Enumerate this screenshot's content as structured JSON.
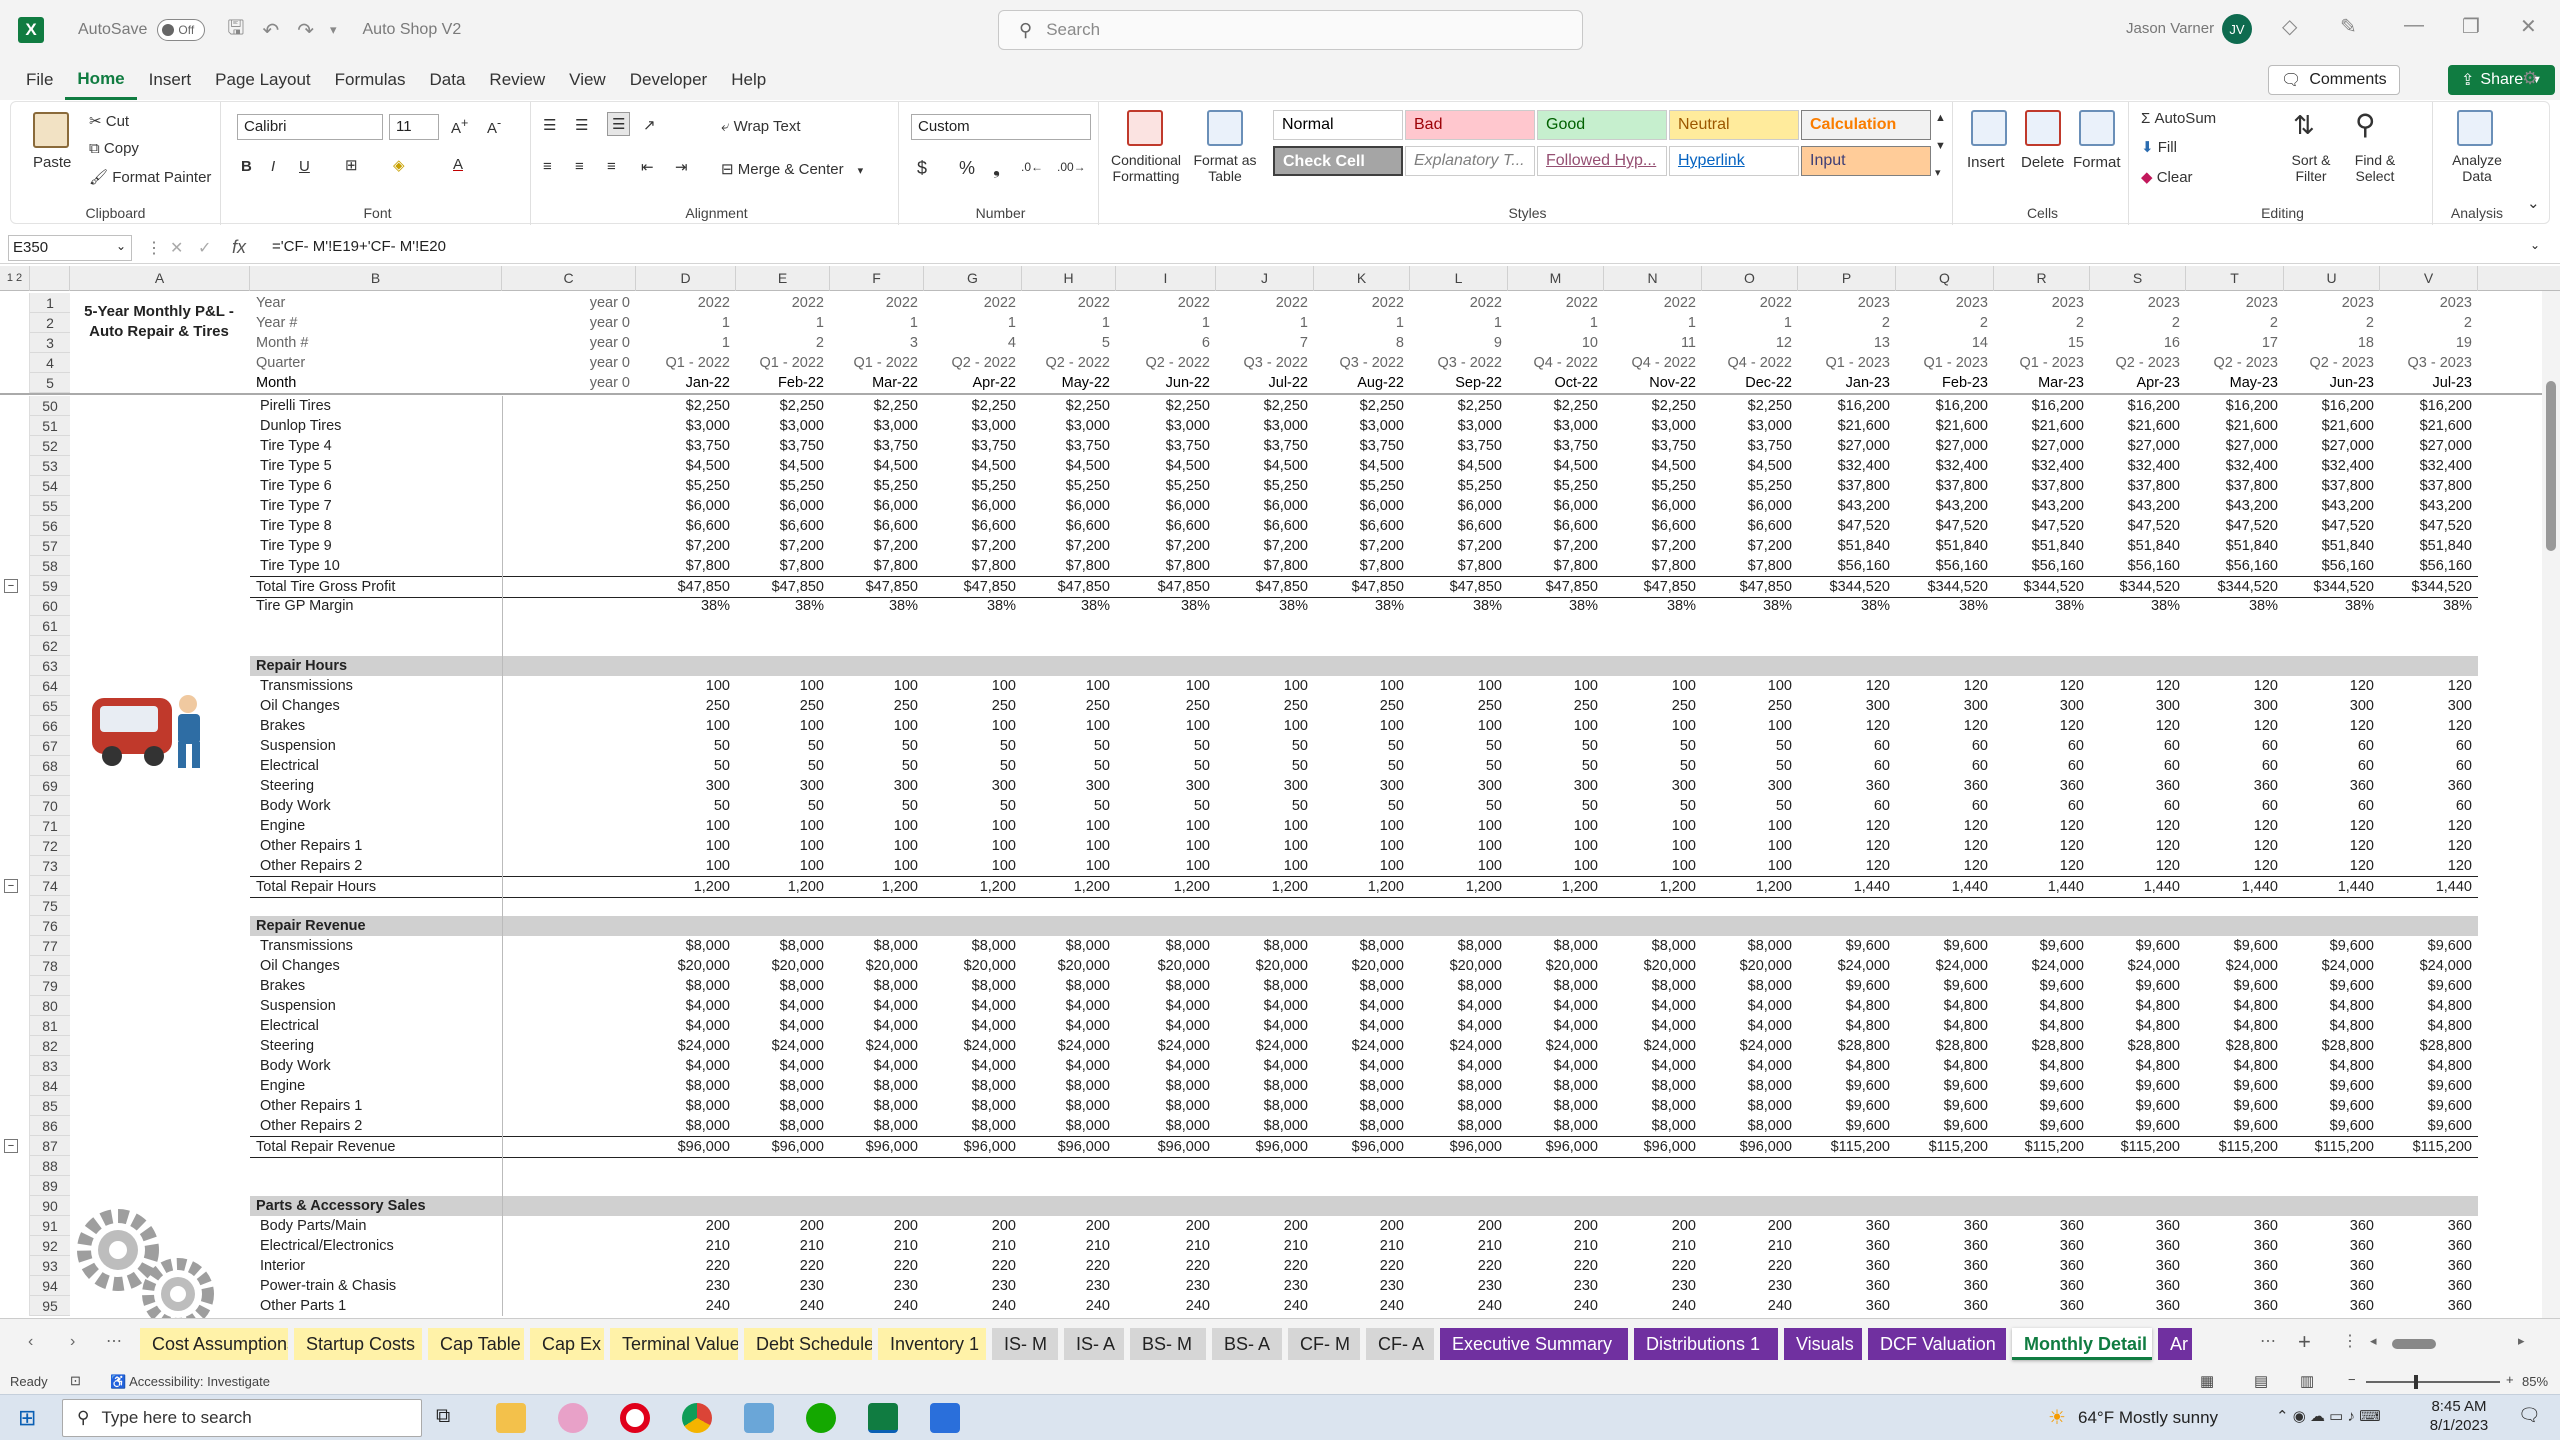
{
  "titlebar": {
    "autosave": "AutoSave",
    "toggle": "Off",
    "filename": "Auto Shop V2",
    "search": "Search",
    "user": "Jason Varner",
    "initials": "JV"
  },
  "menu": [
    "File",
    "Home",
    "Insert",
    "Page Layout",
    "Formulas",
    "Data",
    "Review",
    "View",
    "Developer",
    "Help"
  ],
  "menu_right": {
    "comments": "Comments",
    "share": "Share"
  },
  "ribbon": {
    "clipboard": {
      "paste": "Paste",
      "cut": "Cut",
      "copy": "Copy",
      "format_painter": "Format Painter",
      "label": "Clipboard"
    },
    "font": {
      "name": "Calibri",
      "size": "11",
      "label": "Font"
    },
    "alignment": {
      "wrap": "Wrap Text",
      "merge": "Merge & Center",
      "label": "Alignment"
    },
    "number": {
      "format": "Custom",
      "label": "Number"
    },
    "styles": {
      "cond": "Conditional Formatting",
      "table": "Format as Table",
      "cells": [
        {
          "t": "Normal",
          "bg": "#ffffff",
          "c": "#000000"
        },
        {
          "t": "Bad",
          "bg": "#ffc7ce",
          "c": "#9c0006"
        },
        {
          "t": "Good",
          "bg": "#c6efce",
          "c": "#006100"
        },
        {
          "t": "Neutral",
          "bg": "#ffeb9c",
          "c": "#9c5700"
        },
        {
          "t": "Calculation",
          "bg": "#f2f2f2",
          "c": "#fa7d00"
        },
        {
          "t": "Check Cell",
          "bg": "#a5a5a5",
          "c": "#ffffff"
        },
        {
          "t": "Explanatory T...",
          "bg": "#ffffff",
          "c": "#7f7f7f"
        },
        {
          "t": "Followed Hyp...",
          "bg": "#ffffff",
          "c": "#954f72"
        },
        {
          "t": "Hyperlink",
          "bg": "#ffffff",
          "c": "#0563c1"
        },
        {
          "t": "Input",
          "bg": "#ffcc99",
          "c": "#3f3f76"
        }
      ],
      "label": "Styles"
    },
    "cells": {
      "insert": "Insert",
      "delete": "Delete",
      "format": "Format",
      "label": "Cells"
    },
    "editing": {
      "autosum": "AutoSum",
      "fill": "Fill",
      "clear": "Clear",
      "sort": "Sort & Filter",
      "find": "Find & Select",
      "label": "Editing"
    },
    "analysis": {
      "analyze": "Analyze Data",
      "label": "Analysis"
    }
  },
  "formula_bar": {
    "name_box": "E350",
    "formula": "='CF- M'!E19+'CF- M'!E20"
  },
  "columns": [
    "A",
    "B",
    "C",
    "D",
    "E",
    "F",
    "G",
    "H",
    "I",
    "J",
    "K",
    "L",
    "M",
    "N",
    "O",
    "P",
    "Q",
    "R",
    "S",
    "T",
    "U",
    "V"
  ],
  "title_cell": "5-Year Monthly P&L - Auto Repair & Tires",
  "header_rows": [
    {
      "r": "1",
      "label": "Year",
      "c": "year 0",
      "vals": [
        "2022",
        "2022",
        "2022",
        "2022",
        "2022",
        "2022",
        "2022",
        "2022",
        "2022",
        "2022",
        "2022",
        "2022",
        "2023",
        "2023",
        "2023",
        "2023",
        "2023",
        "2023",
        "2023"
      ]
    },
    {
      "r": "2",
      "label": "Year #",
      "c": "year 0",
      "vals": [
        "1",
        "1",
        "1",
        "1",
        "1",
        "1",
        "1",
        "1",
        "1",
        "1",
        "1",
        "1",
        "2",
        "2",
        "2",
        "2",
        "2",
        "2",
        "2"
      ]
    },
    {
      "r": "3",
      "label": "Month #",
      "c": "year 0",
      "vals": [
        "1",
        "2",
        "3",
        "4",
        "5",
        "6",
        "7",
        "8",
        "9",
        "10",
        "11",
        "12",
        "13",
        "14",
        "15",
        "16",
        "17",
        "18",
        "19"
      ]
    },
    {
      "r": "4",
      "label": "Quarter",
      "c": "year 0",
      "vals": [
        "Q1 - 2022",
        "Q1 - 2022",
        "Q1 - 2022",
        "Q2 - 2022",
        "Q2 - 2022",
        "Q2 - 2022",
        "Q3 - 2022",
        "Q3 - 2022",
        "Q3 - 2022",
        "Q4 - 2022",
        "Q4 - 2022",
        "Q4 - 2022",
        "Q1 - 2023",
        "Q1 - 2023",
        "Q1 - 2023",
        "Q2 - 2023",
        "Q2 - 2023",
        "Q2 - 2023",
        "Q3 - 2023"
      ]
    },
    {
      "r": "5",
      "label": "Month",
      "c": "year 0",
      "vals": [
        "Jan-22",
        "Feb-22",
        "Mar-22",
        "Apr-22",
        "May-22",
        "Jun-22",
        "Jul-22",
        "Aug-22",
        "Sep-22",
        "Oct-22",
        "Nov-22",
        "Dec-22",
        "Jan-23",
        "Feb-23",
        "Mar-23",
        "Apr-23",
        "May-23",
        "Jun-23",
        "Jul-23"
      ]
    }
  ],
  "rows": [
    {
      "r": "50",
      "label": "Pirelli Tires",
      "a": "$2,250",
      "b": "$16,200"
    },
    {
      "r": "51",
      "label": "Dunlop Tires",
      "a": "$3,000",
      "b": "$21,600"
    },
    {
      "r": "52",
      "label": "Tire Type 4",
      "a": "$3,750",
      "b": "$27,000"
    },
    {
      "r": "53",
      "label": "Tire Type 5",
      "a": "$4,500",
      "b": "$32,400"
    },
    {
      "r": "54",
      "label": "Tire Type 6",
      "a": "$5,250",
      "b": "$37,800"
    },
    {
      "r": "55",
      "label": "Tire Type 7",
      "a": "$6,000",
      "b": "$43,200"
    },
    {
      "r": "56",
      "label": "Tire Type 8",
      "a": "$6,600",
      "b": "$47,520"
    },
    {
      "r": "57",
      "label": "Tire Type 9",
      "a": "$7,200",
      "b": "$51,840"
    },
    {
      "r": "58",
      "label": "Tire Type 10",
      "a": "$7,800",
      "b": "$56,160"
    },
    {
      "r": "59",
      "label": "Total Tire Gross Profit",
      "a": "$47,850",
      "b": "$344,520",
      "type": "total"
    },
    {
      "r": "60",
      "label": "Tire GP Margin",
      "a": "38%",
      "b": "38%",
      "type": "plain"
    },
    {
      "r": "61",
      "label": "",
      "type": "blank"
    },
    {
      "r": "62",
      "label": "",
      "type": "blank"
    },
    {
      "r": "63",
      "label": "Repair Hours",
      "type": "section"
    },
    {
      "r": "64",
      "label": "Transmissions",
      "a": "100",
      "b": "120"
    },
    {
      "r": "65",
      "label": "Oil Changes",
      "a": "250",
      "b": "300"
    },
    {
      "r": "66",
      "label": "Brakes",
      "a": "100",
      "b": "120"
    },
    {
      "r": "67",
      "label": "Suspension",
      "a": "50",
      "b": "60"
    },
    {
      "r": "68",
      "label": "Electrical",
      "a": "50",
      "b": "60"
    },
    {
      "r": "69",
      "label": "Steering",
      "a": "300",
      "b": "360"
    },
    {
      "r": "70",
      "label": "Body Work",
      "a": "50",
      "b": "60"
    },
    {
      "r": "71",
      "label": "Engine",
      "a": "100",
      "b": "120"
    },
    {
      "r": "72",
      "label": "Other Repairs 1",
      "a": "100",
      "b": "120"
    },
    {
      "r": "73",
      "label": "Other Repairs 2",
      "a": "100",
      "b": "120"
    },
    {
      "r": "74",
      "label": "Total Repair Hours",
      "a": "1,200",
      "b": "1,440",
      "type": "total"
    },
    {
      "r": "75",
      "label": "",
      "type": "blank"
    },
    {
      "r": "76",
      "label": "Repair Revenue",
      "type": "section"
    },
    {
      "r": "77",
      "label": "Transmissions",
      "a": "$8,000",
      "b": "$9,600"
    },
    {
      "r": "78",
      "label": "Oil Changes",
      "a": "$20,000",
      "b": "$24,000"
    },
    {
      "r": "79",
      "label": "Brakes",
      "a": "$8,000",
      "b": "$9,600"
    },
    {
      "r": "80",
      "label": "Suspension",
      "a": "$4,000",
      "b": "$4,800"
    },
    {
      "r": "81",
      "label": "Electrical",
      "a": "$4,000",
      "b": "$4,800"
    },
    {
      "r": "82",
      "label": "Steering",
      "a": "$24,000",
      "b": "$28,800"
    },
    {
      "r": "83",
      "label": "Body Work",
      "a": "$4,000",
      "b": "$4,800"
    },
    {
      "r": "84",
      "label": "Engine",
      "a": "$8,000",
      "b": "$9,600"
    },
    {
      "r": "85",
      "label": "Other Repairs 1",
      "a": "$8,000",
      "b": "$9,600"
    },
    {
      "r": "86",
      "label": "Other Repairs 2",
      "a": "$8,000",
      "b": "$9,600"
    },
    {
      "r": "87",
      "label": "Total Repair Revenue",
      "a": "$96,000",
      "b": "$115,200",
      "type": "total"
    },
    {
      "r": "88",
      "label": "",
      "type": "blank"
    },
    {
      "r": "89",
      "label": "",
      "type": "blank"
    },
    {
      "r": "90",
      "label": "Parts & Accessory Sales",
      "type": "section"
    },
    {
      "r": "91",
      "label": "Body Parts/Main",
      "a": "200",
      "b": "360"
    },
    {
      "r": "92",
      "label": "Electrical/Electronics",
      "a": "210",
      "b": "360"
    },
    {
      "r": "93",
      "label": "Interior",
      "a": "220",
      "b": "360"
    },
    {
      "r": "94",
      "label": "Power-train & Chasis",
      "a": "230",
      "b": "360"
    },
    {
      "r": "95",
      "label": "Other Parts 1",
      "a": "240",
      "b": "360"
    }
  ],
  "sheet_tabs": [
    {
      "t": "Cost Assumptions",
      "bg": "#fff2a8",
      "c": "#222"
    },
    {
      "t": "Startup Costs",
      "bg": "#fff2a8",
      "c": "#222"
    },
    {
      "t": "Cap Table",
      "bg": "#fff2a8",
      "c": "#222"
    },
    {
      "t": "Cap Ex",
      "bg": "#fff2a8",
      "c": "#222"
    },
    {
      "t": "Terminal Value",
      "bg": "#fff2a8",
      "c": "#222"
    },
    {
      "t": "Debt Schedule",
      "bg": "#fff2a8",
      "c": "#222"
    },
    {
      "t": "Inventory 1",
      "bg": "#fff2a8",
      "c": "#222"
    },
    {
      "t": "IS- M",
      "bg": "#d6d6d6",
      "c": "#222"
    },
    {
      "t": "IS- A",
      "bg": "#d6d6d6",
      "c": "#222"
    },
    {
      "t": "BS- M",
      "bg": "#d6d6d6",
      "c": "#222"
    },
    {
      "t": "BS- A",
      "bg": "#d6d6d6",
      "c": "#222"
    },
    {
      "t": "CF- M",
      "bg": "#d6d6d6",
      "c": "#222"
    },
    {
      "t": "CF- A",
      "bg": "#d6d6d6",
      "c": "#222"
    },
    {
      "t": "Executive Summary",
      "bg": "#7030a0",
      "c": "#ffffff"
    },
    {
      "t": "Distributions 1",
      "bg": "#7030a0",
      "c": "#ffffff"
    },
    {
      "t": "Visuals",
      "bg": "#7030a0",
      "c": "#ffffff"
    },
    {
      "t": "DCF Valuation",
      "bg": "#7030a0",
      "c": "#ffffff"
    },
    {
      "t": "Monthly Detail",
      "bg": "#ffffff",
      "c": "#107c41",
      "active": true
    },
    {
      "t": "Ar",
      "bg": "#7030a0",
      "c": "#ffffff"
    }
  ],
  "status": {
    "ready": "Ready",
    "accessibility": "Accessibility: Investigate",
    "zoom": "85%"
  },
  "taskbar": {
    "search": "Type here to search",
    "weather": "64°F  Mostly sunny",
    "time": "8:45 AM",
    "date": "8/1/2023"
  }
}
